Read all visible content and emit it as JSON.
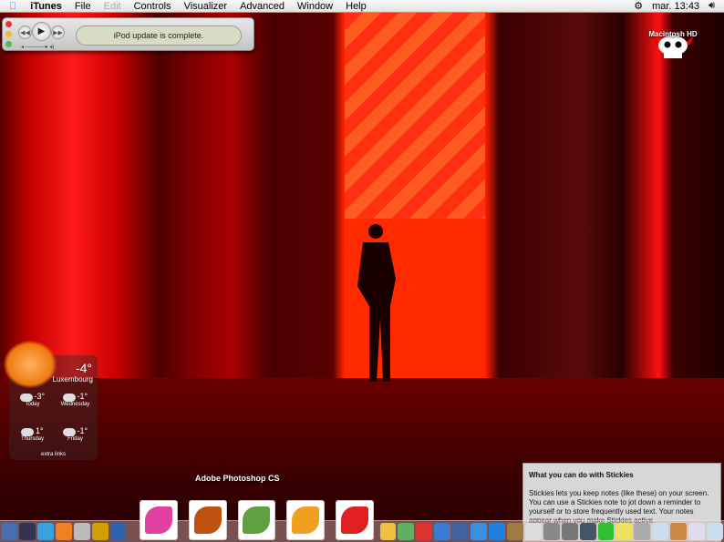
{
  "menubar": {
    "app": "iTunes",
    "items": [
      "File",
      "Edit",
      "Controls",
      "Visualizer",
      "Advanced",
      "Window",
      "Help"
    ],
    "clock": "mar. 13:43"
  },
  "itunes": {
    "status": "iPod update is complete."
  },
  "desktop": {
    "volume_label": "Macintosh HD"
  },
  "weather": {
    "current_temp": "-4°",
    "city": "Luxembourg",
    "forecast": [
      {
        "day": "Today",
        "temp": "-3°"
      },
      {
        "day": "Wednesday",
        "temp": "-1°"
      },
      {
        "day": "Thursday",
        "temp": "1°"
      },
      {
        "day": "Friday",
        "temp": "-1°"
      }
    ],
    "extra": "extra links"
  },
  "stickies": {
    "title": "What you can do with Stickies",
    "body": "Stickies lets you keep notes (like these) on your screen. You can use a Stickies note to jot down a reminder to yourself or to store frequently used text. Your notes appear when you make Stickies active."
  },
  "dock": {
    "tooltip": "Adobe Photoshop CS",
    "items": [
      {
        "name": "imovie",
        "color": "#4a6fb0"
      },
      {
        "name": "final-cut",
        "color": "#335"
      },
      {
        "name": "word",
        "color": "#3aa0e0"
      },
      {
        "name": "powerpoint",
        "color": "#f08020"
      },
      {
        "name": "toaster",
        "color": "#bbb"
      },
      {
        "name": "speed-download",
        "color": "#d0a000"
      },
      {
        "name": "quicksilver",
        "color": "#3060b0"
      },
      {
        "name": "flower-app",
        "color": "#e040a0",
        "big": true
      },
      {
        "name": "photoshop-butterfly",
        "color": "#c05010",
        "big": true
      },
      {
        "name": "illustrator-feather",
        "color": "#60a040",
        "big": true
      },
      {
        "name": "photoshop-cs",
        "color": "#f0a020",
        "big": true
      },
      {
        "name": "acrobat",
        "color": "#e02020",
        "big": true
      },
      {
        "name": "iphoto",
        "color": "#f0c040"
      },
      {
        "name": "itunes",
        "color": "#60b060"
      },
      {
        "name": "ical",
        "color": "#d33"
      },
      {
        "name": "ichat",
        "color": "#3a7bd5"
      },
      {
        "name": "preview",
        "color": "#4060a0"
      },
      {
        "name": "safari",
        "color": "#3a90e0"
      },
      {
        "name": "quicktime",
        "color": "#2080e0"
      },
      {
        "name": "address-book",
        "color": "#a07a40"
      },
      {
        "name": "system-preferences",
        "color": "#ddd"
      },
      {
        "name": "calculator",
        "color": "#888"
      },
      {
        "name": "image-capture",
        "color": "#777"
      },
      {
        "name": "iphoto-2",
        "color": "#456"
      },
      {
        "name": "dreamweaver",
        "color": "#30c030"
      },
      {
        "name": "stickies",
        "color": "#f0e060"
      },
      {
        "name": "network",
        "color": "#aaa"
      },
      {
        "name": "window-1",
        "color": "#cde"
      },
      {
        "name": "window-2",
        "color": "#c84"
      },
      {
        "name": "window-3",
        "color": "#dde"
      },
      {
        "name": "window-4",
        "color": "#cde"
      }
    ]
  }
}
